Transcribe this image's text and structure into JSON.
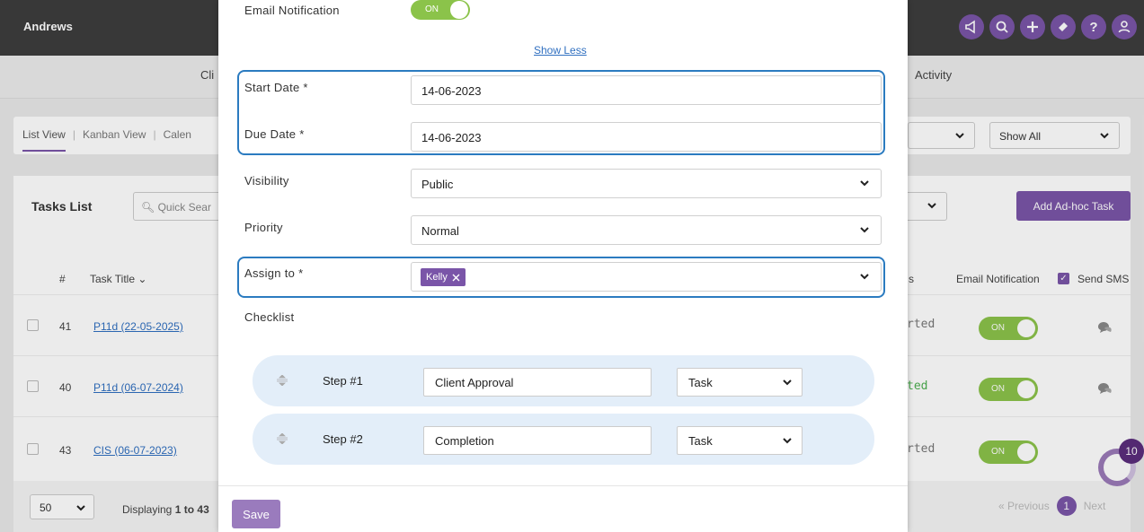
{
  "app": {
    "brand": "Andrews"
  },
  "nav": {
    "left_partial": "Cli",
    "right_item": "Activity"
  },
  "view_tabs": {
    "list_view": "List View",
    "kanban_view": "Kanban View",
    "calendar_partial": "Calen"
  },
  "filters": {
    "show_all": "Show All"
  },
  "tasks": {
    "title": "Tasks List",
    "quick_search_placeholder": "Quick Sear",
    "add_button": "Add Ad-hoc Task",
    "columns": {
      "number": "#",
      "task_title": "Task Title",
      "status_partial": "s",
      "email_notification": "Email Notification",
      "send_sms": "Send SMS"
    },
    "rows": [
      {
        "number": "41",
        "title": "P11d (22-05-2025)",
        "status": "rted",
        "toggle": "ON"
      },
      {
        "number": "40",
        "title": "P11d (06-07-2024)",
        "status": "ted",
        "toggle": "ON"
      },
      {
        "number": "43",
        "title": "CIS (06-07-2023)",
        "status": "rted",
        "toggle": "ON"
      }
    ]
  },
  "footer": {
    "per_page": "50",
    "displaying_prefix": "Displaying",
    "displaying_from": "1",
    "displaying_to_partial": "to 43",
    "pager_previous": "« Previous",
    "pager_current": "1",
    "pager_next": "Next"
  },
  "chat": {
    "badge_count": "10"
  },
  "modal": {
    "email_notification_label": "Email Notification",
    "email_notification_toggle": "ON",
    "show_less": "Show Less",
    "start_date_label": "Start Date *",
    "start_date_value": "14-06-2023",
    "due_date_label": "Due Date *",
    "due_date_value": "14-06-2023",
    "visibility_label": "Visibility",
    "visibility_value": "Public",
    "priority_label": "Priority",
    "priority_value": "Normal",
    "assign_label": "Assign to *",
    "assign_tag": "Kelly",
    "checklist_label": "Checklist",
    "steps": [
      {
        "label": "Step #1",
        "name": "Client Approval",
        "type": "Task"
      },
      {
        "label": "Step #2",
        "name": "Completion",
        "type": "Task"
      }
    ],
    "save_button": "Save"
  },
  "colors": {
    "accent": "#7a55a8",
    "toggle_on": "#8bc34a",
    "highlight": "#2b7bc0",
    "link": "#2f6fc0"
  }
}
